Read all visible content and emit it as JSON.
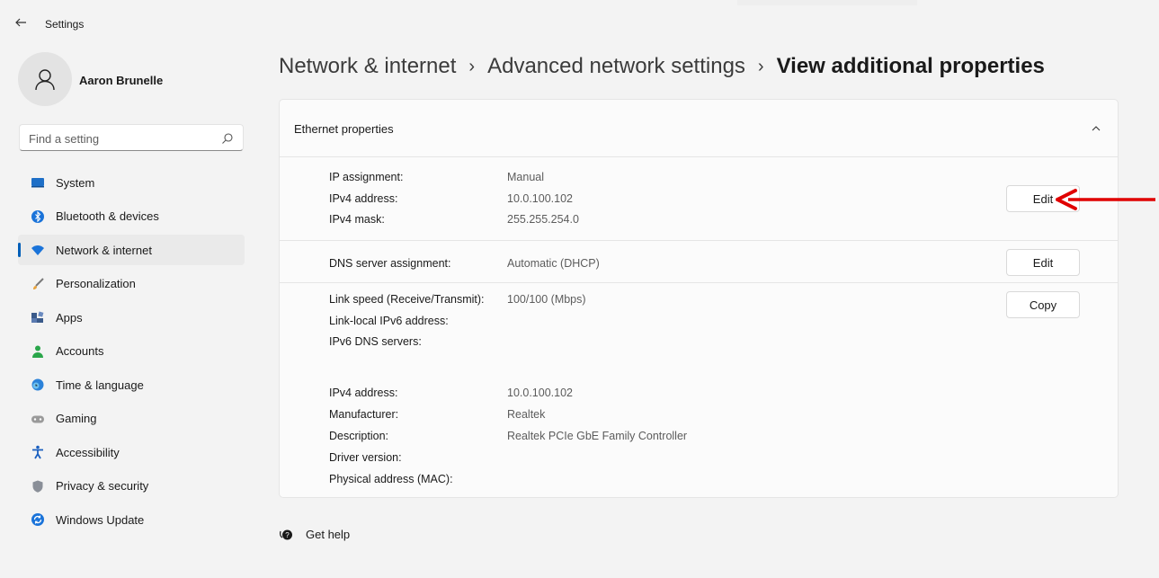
{
  "app": {
    "title": "Settings"
  },
  "profile": {
    "name": "Aaron Brunelle"
  },
  "search": {
    "placeholder": "Find a setting"
  },
  "sidebar": {
    "items": [
      {
        "label": "System",
        "icon": "system-icon",
        "active": false
      },
      {
        "label": "Bluetooth & devices",
        "icon": "bluetooth-icon",
        "active": false
      },
      {
        "label": "Network & internet",
        "icon": "wifi-icon",
        "active": true
      },
      {
        "label": "Personalization",
        "icon": "brush-icon",
        "active": false
      },
      {
        "label": "Apps",
        "icon": "apps-icon",
        "active": false
      },
      {
        "label": "Accounts",
        "icon": "person-icon",
        "active": false
      },
      {
        "label": "Time & language",
        "icon": "globe-clock-icon",
        "active": false
      },
      {
        "label": "Gaming",
        "icon": "gamepad-icon",
        "active": false
      },
      {
        "label": "Accessibility",
        "icon": "accessibility-icon",
        "active": false
      },
      {
        "label": "Privacy & security",
        "icon": "shield-icon",
        "active": false
      },
      {
        "label": "Windows Update",
        "icon": "update-icon",
        "active": false
      }
    ]
  },
  "breadcrumb": {
    "items": [
      "Network & internet",
      "Advanced network settings"
    ],
    "current": "View additional properties",
    "separator": "›"
  },
  "card": {
    "title": "Ethernet properties",
    "ip_section": {
      "rows": [
        {
          "label": "IP assignment:",
          "value": "Manual"
        },
        {
          "label": "IPv4 address:",
          "value": "10.0.100.102"
        },
        {
          "label": "IPv4 mask:",
          "value": "255.255.254.0"
        }
      ],
      "button": "Edit"
    },
    "dns_section": {
      "rows": [
        {
          "label": "DNS server assignment:",
          "value": "Automatic (DHCP)"
        }
      ],
      "button": "Edit"
    },
    "info_section": {
      "rows": [
        {
          "label": "Link speed (Receive/Transmit):",
          "value": "100/100 (Mbps)"
        },
        {
          "label": "Link-local IPv6 address:",
          "value": ""
        },
        {
          "label": "IPv6 DNS servers:",
          "value": ""
        },
        {
          "label": "IPv4 address:",
          "value": "10.0.100.102"
        },
        {
          "label": "Manufacturer:",
          "value": "Realtek"
        },
        {
          "label": "Description:",
          "value": "Realtek PCIe GbE Family Controller"
        },
        {
          "label": "Driver version:",
          "value": ""
        },
        {
          "label": "Physical address (MAC):",
          "value": ""
        }
      ],
      "button": "Copy"
    }
  },
  "help": {
    "label": "Get help"
  },
  "colors": {
    "accent": "#005fb8",
    "annotation_arrow": "#e00000",
    "background": "#f3f3f3",
    "card": "#fbfbfb"
  }
}
